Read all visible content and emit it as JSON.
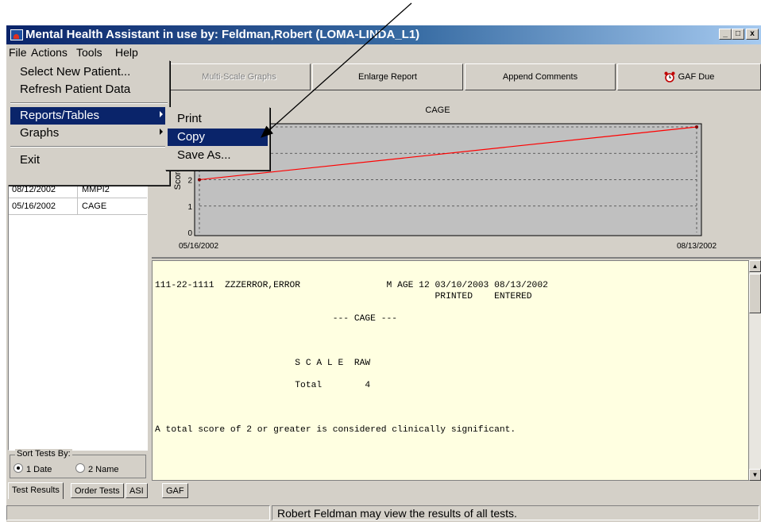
{
  "window": {
    "title": "Mental Health Assistant in use by: Feldman,Robert  (LOMA-LINDA_L1)",
    "buttons": [
      "_",
      "□",
      "x"
    ]
  },
  "menubar": [
    "File",
    "Actions",
    "Tools",
    "Help"
  ],
  "toolbar": {
    "multiscale": "Multi-Scale Graphs",
    "enlarge": "Enlarge Report",
    "append": "Append Comments",
    "gaf_due": "GAF Due"
  },
  "file_menu": {
    "items": [
      "Select New Patient...",
      "Refresh Patient Data",
      "Reports/Tables",
      "Graphs",
      "Exit"
    ]
  },
  "submenu": {
    "items": [
      "Print",
      "Copy",
      "Save As..."
    ],
    "highlighted": "Copy"
  },
  "tests": [
    {
      "date": "08/12/2002",
      "name": "MMPI2"
    },
    {
      "date": "05/16/2002",
      "name": "CAGE"
    }
  ],
  "sort": {
    "label": "Sort Tests By:",
    "options": [
      "1 Date",
      "2 Name"
    ],
    "selected": "1 Date"
  },
  "chart_data": {
    "type": "line",
    "title": "CAGE",
    "ylabel": "Score",
    "x": [
      "05/16/2002",
      "08/13/2002"
    ],
    "y_ticks": [
      0,
      1,
      2
    ],
    "series": [
      {
        "values": [
          2,
          4
        ],
        "color": "#ff0000"
      }
    ],
    "ylim": [
      0,
      4
    ],
    "grid": true
  },
  "report_lines": [
    "111-22-1111  ZZZERROR,ERROR                M AGE 12 03/10/2003 08/13/2002",
    "                                                    PRINTED    ENTERED",
    "",
    "                                 --- CAGE ---",
    "",
    "",
    "",
    "                          S C A L E  RAW",
    "",
    "                          Total        4",
    "",
    "",
    "",
    "A total score of 2 or greater is considered clinically significant."
  ],
  "tabs": [
    "Test Results",
    "Order Tests",
    "ASI",
    "GAF"
  ],
  "status": {
    "message": "Robert Feldman may view the results of all tests."
  },
  "colors": {
    "highlight": "#0a246a",
    "line": "#ff0000",
    "report_bg": "#ffffe1"
  }
}
